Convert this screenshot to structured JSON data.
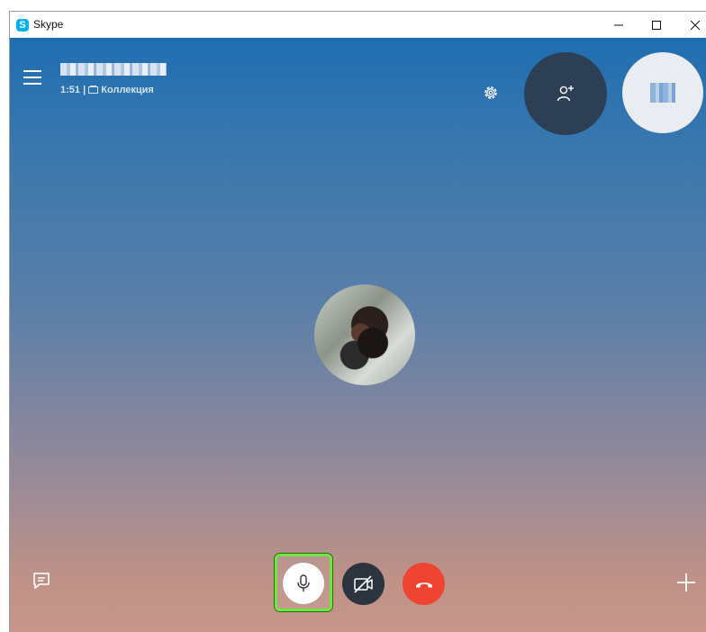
{
  "window": {
    "title": "Skype",
    "logo_letter": "S",
    "controls": {
      "minimize_icon": "minimize-icon",
      "maximize_icon": "maximize-icon",
      "close_icon": "close-icon"
    }
  },
  "call": {
    "duration": "1:51",
    "separator": "|",
    "collection_label": "Коллекция"
  },
  "icons": {
    "menu": "hamburger-menu-icon",
    "settings": "gear-icon",
    "add_participant": "add-person-icon",
    "chat": "chat-icon",
    "microphone": "microphone-icon",
    "video_off": "video-off-icon",
    "hang_up": "hang-up-icon",
    "more": "plus-icon"
  },
  "colors": {
    "skype_blue": "#00aff0",
    "hangup_red": "#f04433",
    "highlight_green": "#6ee83f",
    "dark_button": "#2c3440",
    "add_person_bg": "#2d3f55"
  }
}
